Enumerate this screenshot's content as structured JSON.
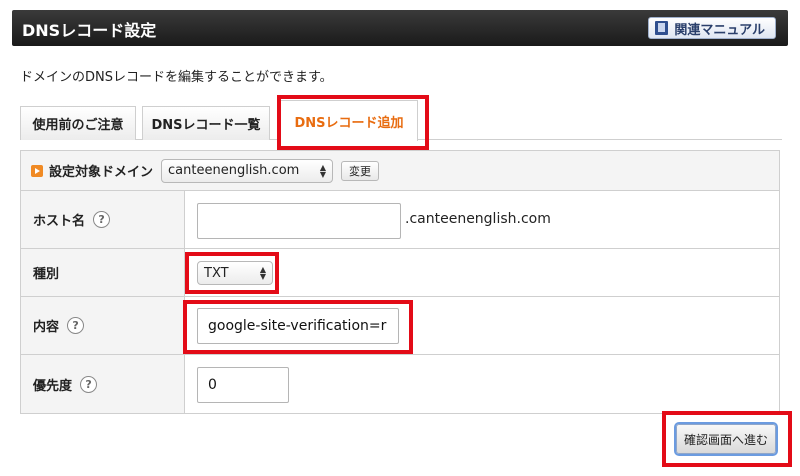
{
  "header": {
    "title": "DNSレコード設定",
    "manual_label": "関連マニュアル"
  },
  "description": "ドメインのDNSレコードを編集することができます。",
  "tabs": [
    {
      "label": "使用前のご注意"
    },
    {
      "label": "DNSレコード一覧"
    },
    {
      "label": "DNSレコード追加"
    }
  ],
  "panel": {
    "target_label": "設定対象ドメイン",
    "domain_selected": "canteenenglish.com",
    "change_label": "変更"
  },
  "form": {
    "host": {
      "label": "ホスト名",
      "value": "",
      "suffix": ".canteenenglish.com"
    },
    "type": {
      "label": "種別",
      "selected": "TXT"
    },
    "content": {
      "label": "内容",
      "value": "google-site-verification=r"
    },
    "priority": {
      "label": "優先度",
      "value": "0"
    },
    "help_glyph": "?"
  },
  "confirm_label": "確認画面へ進む",
  "colors": {
    "highlight": "#e30b17",
    "active_tab": "#e86c10"
  }
}
